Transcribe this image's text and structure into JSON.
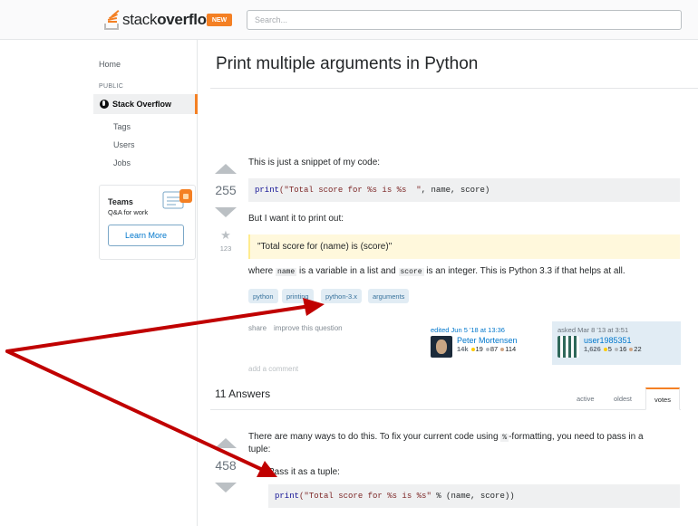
{
  "header": {
    "logo_light": "stack",
    "logo_bold": "overflow",
    "new_badge": "NEW",
    "search_placeholder": "Search..."
  },
  "sidebar": {
    "home": "Home",
    "public_label": "PUBLIC",
    "stack_overflow": "Stack Overflow",
    "items": [
      "Tags",
      "Users",
      "Jobs"
    ],
    "teams": {
      "title": "Teams",
      "subtitle": "Q&A for work",
      "button": "Learn More"
    }
  },
  "question": {
    "title": "Print multiple arguments in Python",
    "votes": "255",
    "favorites": "123",
    "intro": "This is just a snippet of my code:",
    "code_fn": "print",
    "code_str": "(\"Total score for %s is %s  \"",
    "code_rest": ", name, score)",
    "want": "But I want it to print out:",
    "quote": "\"Total score for (name) is (score)\"",
    "where_pre": "where ",
    "where_code1": "name",
    "where_mid": " is a variable in a list and ",
    "where_code2": "score",
    "where_post": " is an integer. This is Python 3.3 if that helps at all.",
    "tags": [
      "python",
      "printing",
      "python-3.x",
      "arguments"
    ],
    "share": "share",
    "improve": "improve this question",
    "edited": {
      "time": "edited Jun 5 '18 at 13:36",
      "name": "Peter Mortensen",
      "rep": "14k",
      "gold": "19",
      "silver": "87",
      "bronze": "114"
    },
    "asked": {
      "time": "asked Mar 8 '13 at 3:51",
      "name": "user1985351",
      "rep": "1,626",
      "gold": "5",
      "silver": "16",
      "bronze": "22"
    },
    "add_comment": "add a comment"
  },
  "answers": {
    "heading": "11 Answers",
    "tabs": [
      "active",
      "oldest",
      "votes"
    ],
    "first": {
      "votes": "458",
      "line1_pre": "There are many ways to do this. To fix your current code using ",
      "line1_code": "%",
      "line1_post": "-formatting, you need to pass in a",
      "line2": "tuple:",
      "step": "Pass it as a tuple:",
      "code_fn": "print",
      "code_str": "(\"Total score for %s is %s\"",
      "code_rest": " % (name, score))"
    }
  },
  "colors": {
    "accent": "#f48024",
    "link": "#0077cc",
    "tag_bg": "#e1ecf4",
    "arrow": "#c00000",
    "gold": "#ffcc01",
    "silver": "#b4b8bc",
    "bronze": "#d1a684"
  }
}
